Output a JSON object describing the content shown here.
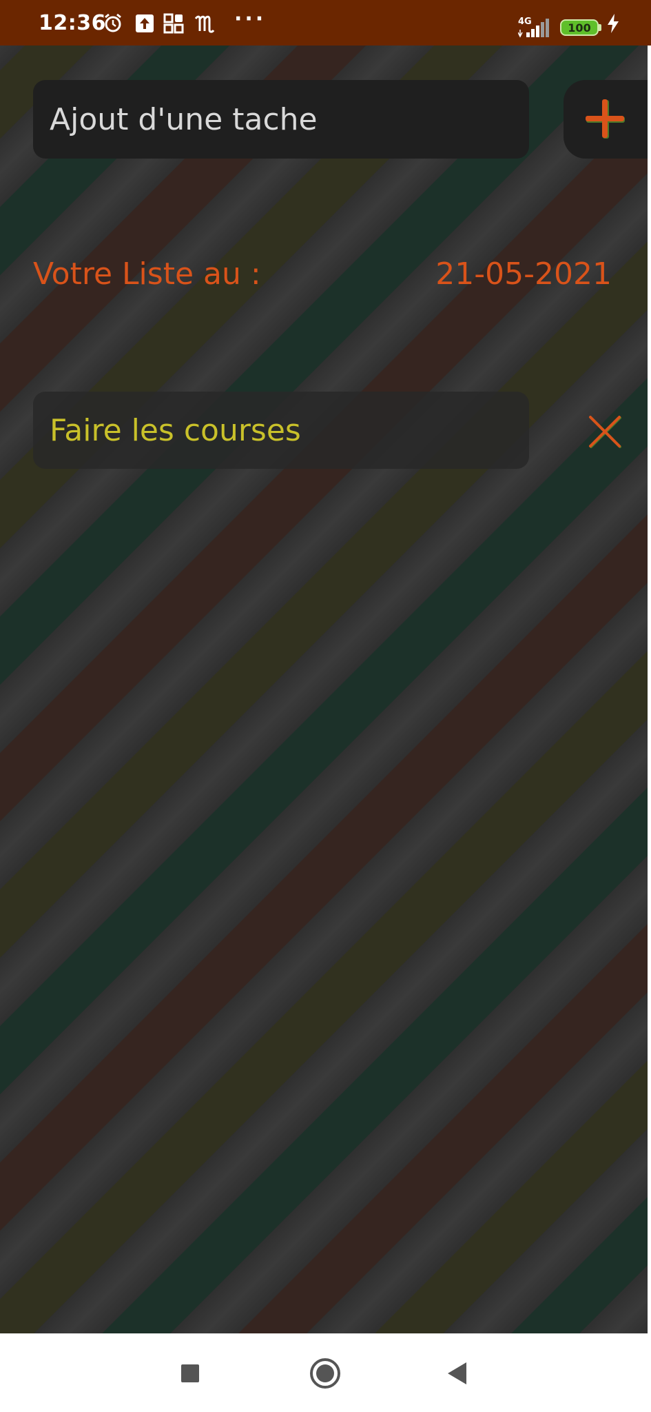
{
  "status_bar": {
    "time": "12:36",
    "network": "4G",
    "battery": "100",
    "icons": [
      "alarm-icon",
      "upload-icon",
      "grid-app-icon",
      "lemonde-icon",
      "more-dots-icon",
      "signal-icon",
      "battery-icon",
      "charging-icon"
    ]
  },
  "task_input": {
    "placeholder": "Ajout d'une tache"
  },
  "add_button": {
    "icon": "plus-icon",
    "color": "#d9531a"
  },
  "list_header": {
    "label": "Votre Liste au :",
    "date": "21-05-2021"
  },
  "tasks": [
    {
      "text": "Faire les courses",
      "delete_icon": "close-icon"
    }
  ],
  "nav_bar": {
    "buttons": [
      "recents-button",
      "home-button",
      "back-button"
    ]
  },
  "colors": {
    "status_bar": "#6b2600",
    "accent": "#d9531a",
    "task_text": "#c9c12a",
    "input_bg": "#1f1f1f"
  }
}
